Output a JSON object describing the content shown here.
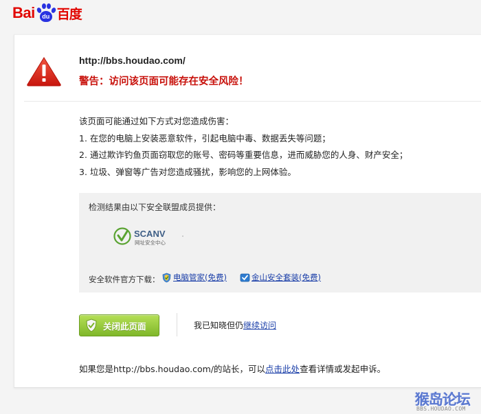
{
  "header": {
    "logo_left": "Bai",
    "logo_pad": "du",
    "logo_right": "百度"
  },
  "alert": {
    "url": "http://bbs.houdao.com/",
    "warning": "警告：访问该页面可能存在安全风险！"
  },
  "harm": {
    "intro": "该页面可能通过如下方式对您造成伤害：",
    "items": [
      "1. 在您的电脑上安装恶意软件，引起电脑中毒、数据丢失等问题；",
      "2. 通过欺诈钓鱼页面窃取您的账号、密码等重要信息，进而威胁您的人身、财产安全；",
      "3. 垃圾、弹窗等广告对您造成骚扰，影响您的上网体验。"
    ]
  },
  "provider": {
    "title": "检测结果由以下安全联盟成员提供：",
    "scan_logo_text": "SCANV",
    "scan_logo_sub": "网址安全中心",
    "download_label": "安全软件官方下载：",
    "download_links": [
      {
        "label": "电脑管家(免费)",
        "icon": "tencent-guard-icon"
      },
      {
        "label": "金山安全套装(免费)",
        "icon": "kingsoft-shield-icon"
      }
    ]
  },
  "actions": {
    "close_button": "关闭此页面",
    "continue_prefix": "我已知晓但仍",
    "continue_link": "继续访问"
  },
  "owner": {
    "prefix": "如果您是http://bbs.houdao.com/的站长，可以",
    "link": "点击此处",
    "suffix": "查看详情或发起申诉。"
  },
  "watermark": {
    "main": "猴岛论坛",
    "sub": "BBS.HOUDAO.COM"
  },
  "colors": {
    "brand_red": "#e10601",
    "brand_blue": "#2932e1",
    "warning_red": "#c8120c",
    "link_blue": "#1a3ea8",
    "button_green": "#8cc332"
  }
}
